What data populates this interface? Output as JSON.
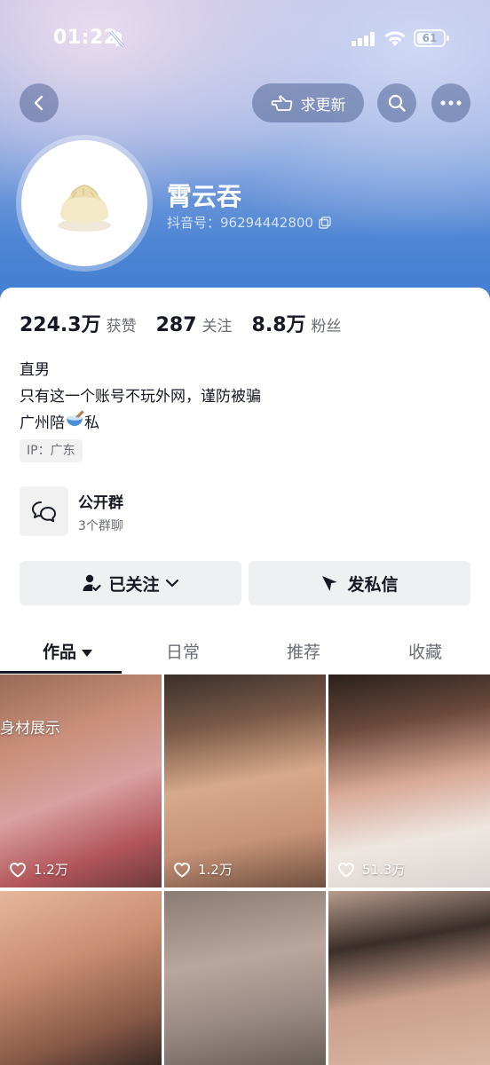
{
  "status_bar": {
    "time": "01:22",
    "battery": "61"
  },
  "header": {
    "request_update_label": "求更新",
    "profile_name": "霄云吞",
    "douyin_id": "抖音号：96294442800"
  },
  "stats": [
    {
      "value": "224.3万",
      "label": "获赞"
    },
    {
      "value": "287",
      "label": "关注"
    },
    {
      "value": "8.8万",
      "label": "粉丝"
    }
  ],
  "bio": {
    "line1": "直男",
    "line2": "只有这一个账号不玩外网，谨防被骗",
    "line3_prefix": "广州陪",
    "line3_suffix": "私",
    "ip": "IP：广东"
  },
  "group": {
    "title": "公开群",
    "subtitle": "3个群聊"
  },
  "actions": {
    "follow_label": "已关注",
    "message_label": "发私信"
  },
  "tabs": [
    "作品",
    "日常",
    "推荐",
    "收藏"
  ],
  "videos": [
    {
      "likes": "1.2万",
      "caption": "身材展示"
    },
    {
      "likes": "1.2万"
    },
    {
      "likes": "51.3万"
    },
    {},
    {},
    {}
  ],
  "colors": {
    "hero_blue": "#4f86d4",
    "text_primary": "#161823",
    "text_secondary": "#6b6d74",
    "button_bg": "#eff0f2"
  }
}
